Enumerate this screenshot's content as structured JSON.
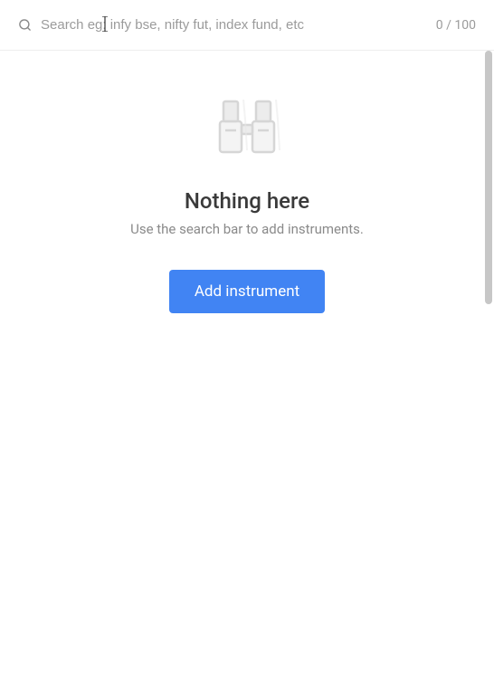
{
  "search": {
    "placeholder": "Search eg: infy bse, nifty fut, index fund, etc",
    "value": "",
    "counter": "0 / 100"
  },
  "empty": {
    "title": "Nothing here",
    "subtitle": "Use the search bar to add instruments.",
    "button_label": "Add instrument"
  }
}
